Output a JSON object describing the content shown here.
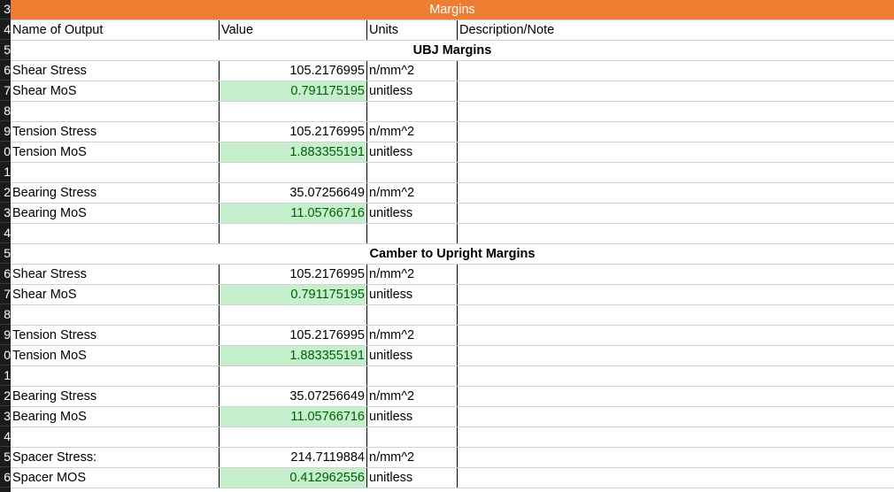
{
  "row_numbers": [
    "3",
    "4",
    "5",
    "6",
    "7",
    "8",
    "9",
    "0",
    "1",
    "2",
    "3",
    "4",
    "5",
    "6",
    "7",
    "8",
    "9",
    "0",
    "1",
    "2",
    "3",
    "4",
    "5",
    "6"
  ],
  "sheet": {
    "title": "Margins",
    "header": {
      "name": "Name of Output",
      "value": "Value",
      "units": "Units",
      "note": "Description/Note"
    },
    "rows": [
      {
        "kind": "section",
        "text": "UBJ Margins"
      },
      {
        "kind": "data",
        "name": "Shear Stress",
        "value": "105.2176995",
        "units": "n/mm^2",
        "note": "",
        "highlight": false
      },
      {
        "kind": "data",
        "name": "Shear MoS",
        "value": "0.791175195",
        "units": "unitless",
        "note": "",
        "highlight": true
      },
      {
        "kind": "blank"
      },
      {
        "kind": "data",
        "name": "Tension Stress",
        "value": "105.2176995",
        "units": "n/mm^2",
        "note": "",
        "highlight": false
      },
      {
        "kind": "data",
        "name": "Tension MoS",
        "value": "1.883355191",
        "units": "unitless",
        "note": "",
        "highlight": true
      },
      {
        "kind": "blank"
      },
      {
        "kind": "data",
        "name": "Bearing Stress",
        "value": "35.07256649",
        "units": "n/mm^2",
        "note": "",
        "highlight": false
      },
      {
        "kind": "data",
        "name": "Bearing MoS",
        "value": "11.05766716",
        "units": "unitless",
        "note": "",
        "highlight": true
      },
      {
        "kind": "blank"
      },
      {
        "kind": "section",
        "text": "Camber to Upright Margins"
      },
      {
        "kind": "data",
        "name": "Shear Stress",
        "value": "105.2176995",
        "units": "n/mm^2",
        "note": "",
        "highlight": false
      },
      {
        "kind": "data",
        "name": "Shear MoS",
        "value": "0.791175195",
        "units": "unitless",
        "note": "",
        "highlight": true
      },
      {
        "kind": "blank"
      },
      {
        "kind": "data",
        "name": "Tension Stress",
        "value": "105.2176995",
        "units": "n/mm^2",
        "note": "",
        "highlight": false
      },
      {
        "kind": "data",
        "name": "Tension MoS",
        "value": "1.883355191",
        "units": "unitless",
        "note": "",
        "highlight": true
      },
      {
        "kind": "blank"
      },
      {
        "kind": "data",
        "name": "Bearing Stress",
        "value": "35.07256649",
        "units": "n/mm^2",
        "note": "",
        "highlight": false
      },
      {
        "kind": "data",
        "name": "Bearing MoS",
        "value": "11.05766716",
        "units": "unitless",
        "note": "",
        "highlight": true
      },
      {
        "kind": "blank"
      },
      {
        "kind": "data",
        "name": "Spacer Stress:",
        "value": "214.7119884",
        "units": "n/mm^2",
        "note": "",
        "highlight": false
      },
      {
        "kind": "data",
        "name": "Spacer MOS",
        "value": "0.412962556",
        "units": "unitless",
        "note": "",
        "highlight": true
      }
    ]
  },
  "colors": {
    "title_bg": "#ED7D31",
    "highlight_bg": "#C6EFCE",
    "highlight_text": "#006100"
  }
}
